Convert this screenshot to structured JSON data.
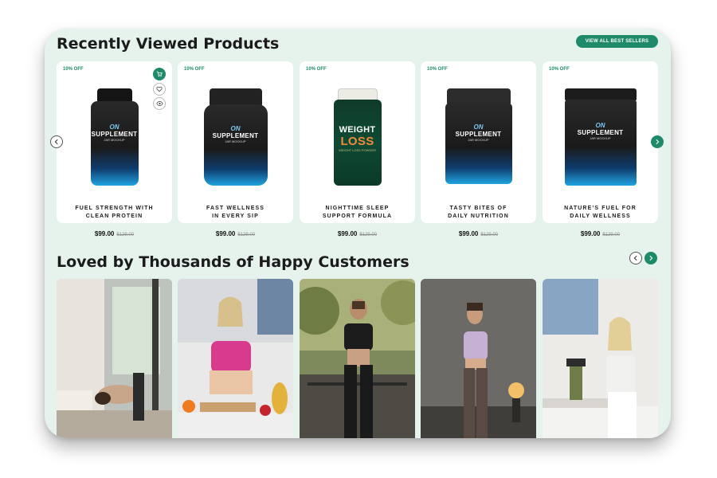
{
  "recently_viewed": {
    "title": "Recently Viewed Products",
    "view_all_label": "VIEW ALL BEST SELLERS",
    "products": [
      {
        "badge": "10% OFF",
        "name_line1": "FUEL STRENGTH WITH",
        "name_line2": "CLEAN PROTEIN",
        "price": "$99.00",
        "old_price": "$129.00",
        "jar_logo": "ON",
        "jar_label": "SUPPLEMENT",
        "jar_sub": "JAR MOCKUP"
      },
      {
        "badge": "10% OFF",
        "name_line1": "FAST WELLNESS",
        "name_line2": "IN EVERY SIP",
        "price": "$99.00",
        "old_price": "$129.00",
        "jar_logo": "ON",
        "jar_label": "SUPPLEMENT",
        "jar_sub": "JAR MOCKUP"
      },
      {
        "badge": "10% OFF",
        "name_line1": "NIGHTTIME SLEEP",
        "name_line2": "SUPPORT FORMULA",
        "price": "$99.00",
        "old_price": "$129.00",
        "jar_logo": "",
        "jar_label": "WEIGHT",
        "jar_label2": "LOSS",
        "jar_sub": "WEIGHT LOSS POWDER"
      },
      {
        "badge": "10% OFF",
        "name_line1": "TASTY BITES OF",
        "name_line2": "DAILY NUTRITION",
        "price": "$99.00",
        "old_price": "$129.00",
        "jar_logo": "ON",
        "jar_label": "SUPPLEMENT",
        "jar_sub": "JAR MOCKUP"
      },
      {
        "badge": "10% OFF",
        "name_line1": "NATURE’S FUEL FOR",
        "name_line2": "DAILY WELLNESS",
        "price": "$99.00",
        "old_price": "$129.00",
        "jar_logo": "ON",
        "jar_label": "SUPPLEMENT",
        "jar_sub": "JAR MOCKUP"
      }
    ],
    "card_icons": [
      "cart-icon",
      "heart-icon",
      "eye-icon"
    ]
  },
  "customers": {
    "title": "Loved by Thousands of Happy Customers",
    "photos": [
      "woman-stretching-photo",
      "woman-cooking-photo",
      "woman-outdoor-workout-photo",
      "woman-dancing-photo",
      "woman-blender-photo"
    ]
  },
  "colors": {
    "accent": "#1e8a6a",
    "background": "#e6f3ec",
    "card": "#ffffff"
  }
}
